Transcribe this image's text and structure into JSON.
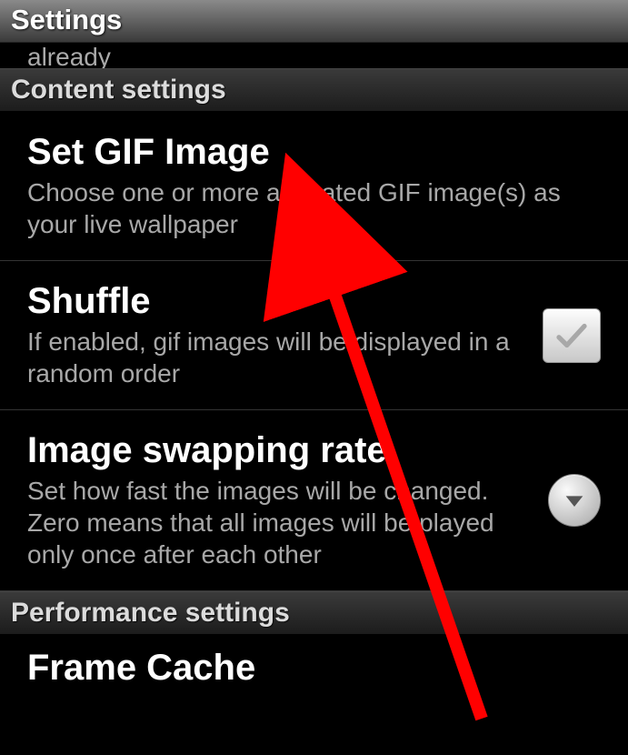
{
  "header": {
    "title": "Settings"
  },
  "truncated_top": "already",
  "sections": {
    "content": {
      "label": "Content settings",
      "items": {
        "set_gif": {
          "title": "Set GIF Image",
          "summary": "Choose one or more animated GIF image(s) as your live wallpaper"
        },
        "shuffle": {
          "title": "Shuffle",
          "summary": "If enabled, gif images will be displayed in a random order",
          "checked": false
        },
        "swap_rate": {
          "title": "Image swapping rate",
          "summary": "Set how fast the images will be changed. Zero means that all images will be played only once after each other"
        }
      }
    },
    "performance": {
      "label": "Performance settings",
      "items": {
        "frame_cache": {
          "title": "Frame Cache"
        }
      }
    }
  },
  "annotation": {
    "arrow_color": "#ff0000"
  }
}
